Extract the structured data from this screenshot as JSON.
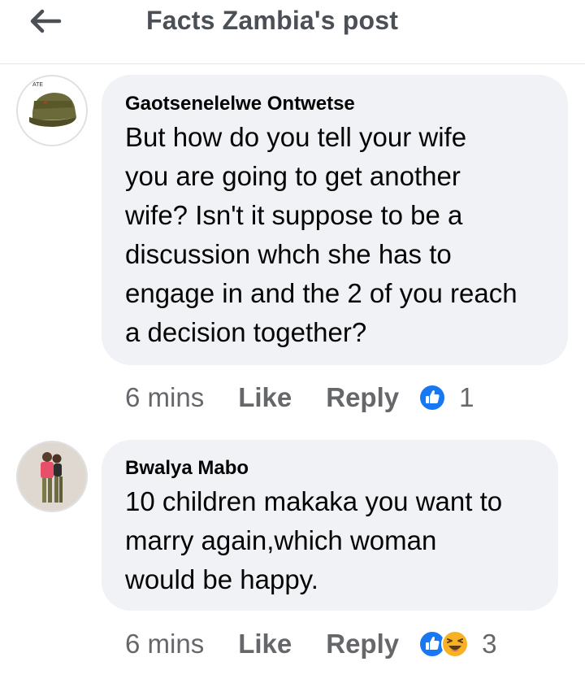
{
  "header": {
    "title": "Facts Zambia's post",
    "back_icon": "arrow-left-icon"
  },
  "comments": [
    {
      "author": "Gaotsenelelwe Ontwetse",
      "avatar_icon": "military-cap-avatar",
      "avatar_text": "ATE",
      "text_lines": [
        "But how do you tell your wife",
        "you are going to get another",
        "wife? Isn't it suppose to be a",
        "discussion whch she has to",
        "engage in and the 2 of you reach",
        "a decision together?"
      ],
      "time": "6 mins",
      "like_label": "Like",
      "reply_label": "Reply",
      "reactions": [
        "like-reaction-icon"
      ],
      "reaction_count": "1"
    },
    {
      "author": "Bwalya Mabo",
      "avatar_icon": "couple-photo-avatar",
      "text_lines": [
        "10 children makaka you want to",
        "marry again,which woman",
        "would be happy."
      ],
      "time": "6 mins",
      "like_label": "Like",
      "reply_label": "Reply",
      "reactions": [
        "like-reaction-icon",
        "haha-reaction-icon"
      ],
      "reaction_count": "3"
    }
  ],
  "colors": {
    "like_blue": "#1877f2",
    "haha_yellow": "#f7b125",
    "bubble_gray": "#f0f2f5",
    "meta_gray": "#65676b"
  }
}
